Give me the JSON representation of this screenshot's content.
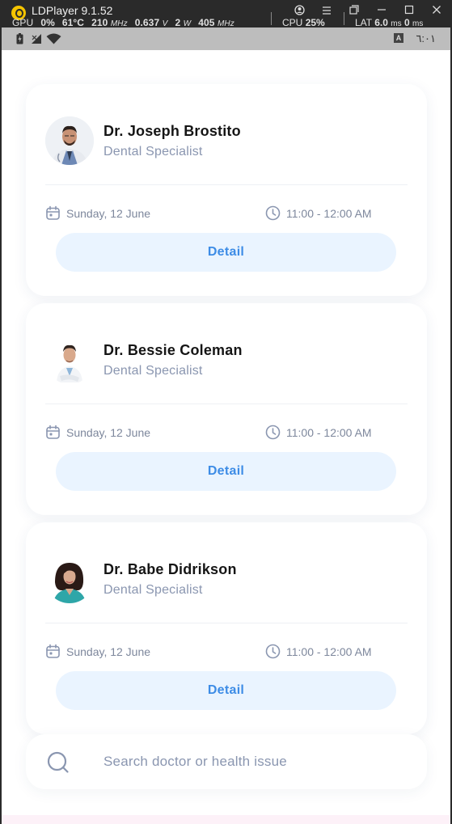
{
  "window": {
    "title": "LDPlayer 9.1.52",
    "stats": {
      "gpu_label": "GPU",
      "gpu_value": "0%",
      "temp": "61°C",
      "mhz1": "210",
      "mhz_unit": "MHz",
      "volt": "0.637",
      "volt_unit": "V",
      "watt": "2",
      "watt_unit": "W",
      "mhz2": "405",
      "cpu_label": "CPU",
      "cpu_value": "25%",
      "lat_label": "LAT",
      "lat1": "6.0",
      "lat2": "0",
      "ms_unit": "ms"
    }
  },
  "statusbar": {
    "time": "٦:٠١",
    "a_badge": "A"
  },
  "appointments": [
    {
      "doctor": "Dr. Joseph Brostito",
      "specialty": "Dental Specialist",
      "date": "Sunday, 12 June",
      "time": "11:00 - 12:00 AM",
      "button": "Detail"
    },
    {
      "doctor": "Dr. Bessie Coleman",
      "specialty": "Dental Specialist",
      "date": "Sunday, 12 June",
      "time": "11:00 - 12:00 AM",
      "button": "Detail"
    },
    {
      "doctor": "Dr. Babe Didrikson",
      "specialty": "Dental Specialist",
      "date": "Sunday, 12 June",
      "time": "11:00 - 12:00 AM",
      "button": "Detail"
    }
  ],
  "search": {
    "placeholder": "Search doctor or health issue"
  },
  "colors": {
    "accent": "#3d8ce6",
    "button_bg": "#eaf4ff",
    "muted": "#8a96b0"
  }
}
